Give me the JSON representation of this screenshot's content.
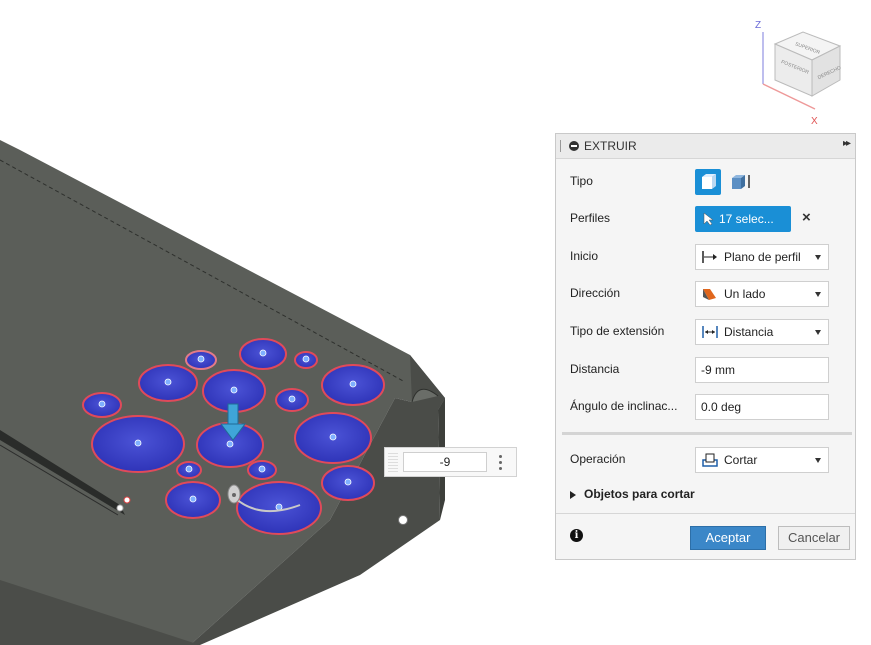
{
  "viewcube": {
    "axis_z": "Z",
    "axis_x": "X",
    "face_top": "SUPERIOR",
    "face_left": "POSTERIOR",
    "face_right": "DERECHO"
  },
  "extrude_panel": {
    "title": "EXTRUIR",
    "rows": {
      "tipo": {
        "label": "Tipo"
      },
      "perfiles": {
        "label": "Perfiles",
        "selection": "17 selec..."
      },
      "inicio": {
        "label": "Inicio",
        "value": "Plano de perfil"
      },
      "direccion": {
        "label": "Dirección",
        "value": "Un lado"
      },
      "tipo_extension": {
        "label": "Tipo de extensión",
        "value": "Distancia"
      },
      "distancia": {
        "label": "Distancia",
        "value": "-9 mm"
      },
      "angulo": {
        "label": "Ángulo de inclinac...",
        "value": "0.0 deg"
      },
      "operacion": {
        "label": "Operación",
        "value": "Cortar"
      }
    },
    "objetos_para_cortar": "Objetos para cortar",
    "accept_label": "Aceptar",
    "cancel_label": "Cancelar"
  },
  "dimension_input": {
    "value": "-9"
  },
  "colors": {
    "accent": "#1a8fd6",
    "profile_fill": "#3a3fc0",
    "profile_edge": "#e04a5a",
    "body": "#5a5d58"
  }
}
